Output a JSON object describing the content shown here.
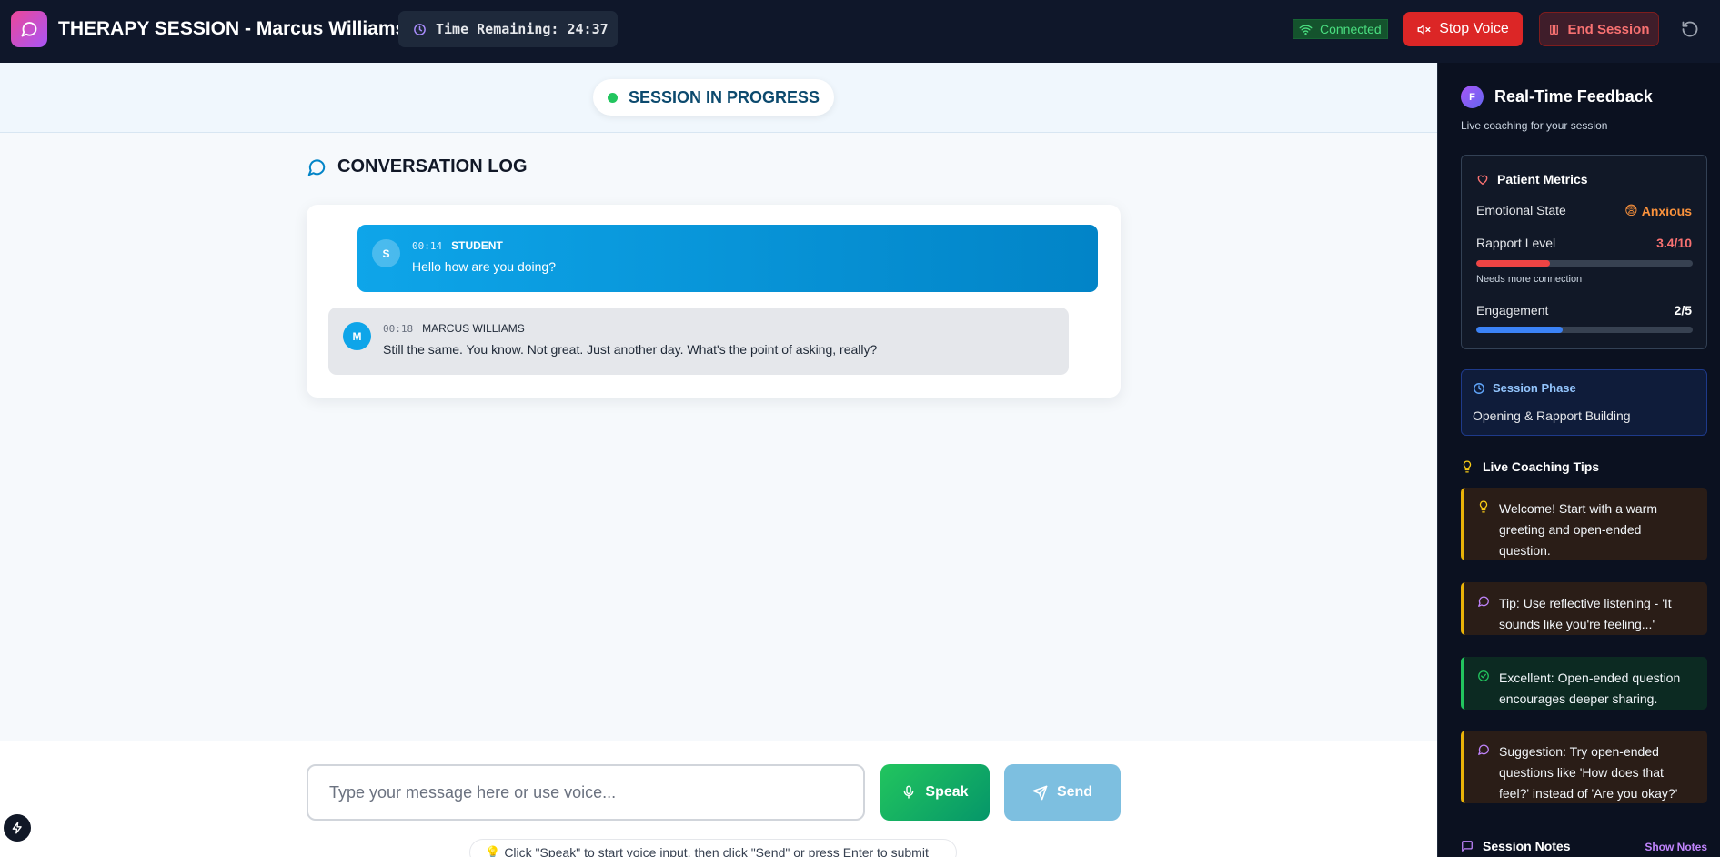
{
  "header": {
    "title": "THERAPY SESSION - Marcus Williams",
    "timer_text": "Time Remaining: 24:37",
    "connection_status": "Connected",
    "stop_voice_label": "Stop Voice",
    "end_session_label": "End Session"
  },
  "status": {
    "label": "SESSION IN PROGRESS"
  },
  "conversation": {
    "title": "CONVERSATION LOG",
    "messages": [
      {
        "initial": "S",
        "time": "00:14",
        "speaker": "STUDENT",
        "text": "Hello how are you doing?"
      },
      {
        "initial": "M",
        "time": "00:18",
        "speaker": "MARCUS WILLIAMS",
        "text": "Still the same. You know. Not great. Just another day. What's the point of asking, really?"
      }
    ]
  },
  "composer": {
    "placeholder": "Type your message here or use voice...",
    "speak_label": "Speak",
    "send_label": "Send",
    "hint": "💡 Click \"Speak\" to start voice input, then click \"Send\" or press Enter to submit"
  },
  "sidebar": {
    "badge": "F",
    "title": "Real-Time Feedback",
    "subtitle": "Live coaching for your session",
    "metrics": {
      "title": "Patient Metrics",
      "emotional_state_label": "Emotional State",
      "emotional_state_emoji": "😨",
      "emotional_state_value": "Anxious",
      "rapport_label": "Rapport Level",
      "rapport_value": "3.4/10",
      "rapport_fraction": 0.34,
      "rapport_note": "Needs more connection",
      "engagement_label": "Engagement",
      "engagement_value": "2/5",
      "engagement_fraction": 0.4
    },
    "phase": {
      "title": "Session Phase",
      "value": "Opening & Rapport Building"
    },
    "tips_title": "Live Coaching Tips",
    "tips": [
      "Welcome! Start with a warm greeting and open-ended question.",
      "Tip: Use reflective listening - 'It sounds like you're feeling...'",
      "Excellent: Open-ended question encourages deeper sharing.",
      "Suggestion: Try open-ended questions like 'How does that feel?' instead of 'Are you okay?'"
    ],
    "notes_title": "Session Notes",
    "notes_toggle": "Show Notes"
  },
  "colors": {
    "header_bg": "#0f172a",
    "accent_blue": "#0ea5e9",
    "speak_green": "#22c55e",
    "danger_red": "#dc2626",
    "warn_yellow": "#eab308",
    "tip_purple": "#c084fc"
  },
  "icons": {
    "logo": "chat-bubble-icon",
    "timer": "clock-icon",
    "connection": "wifi-icon",
    "stop_voice": "volume-mute-icon",
    "end_session": "columns-icon",
    "reset": "rotate-ccw-icon",
    "speak": "microphone-icon",
    "send": "send-icon"
  }
}
